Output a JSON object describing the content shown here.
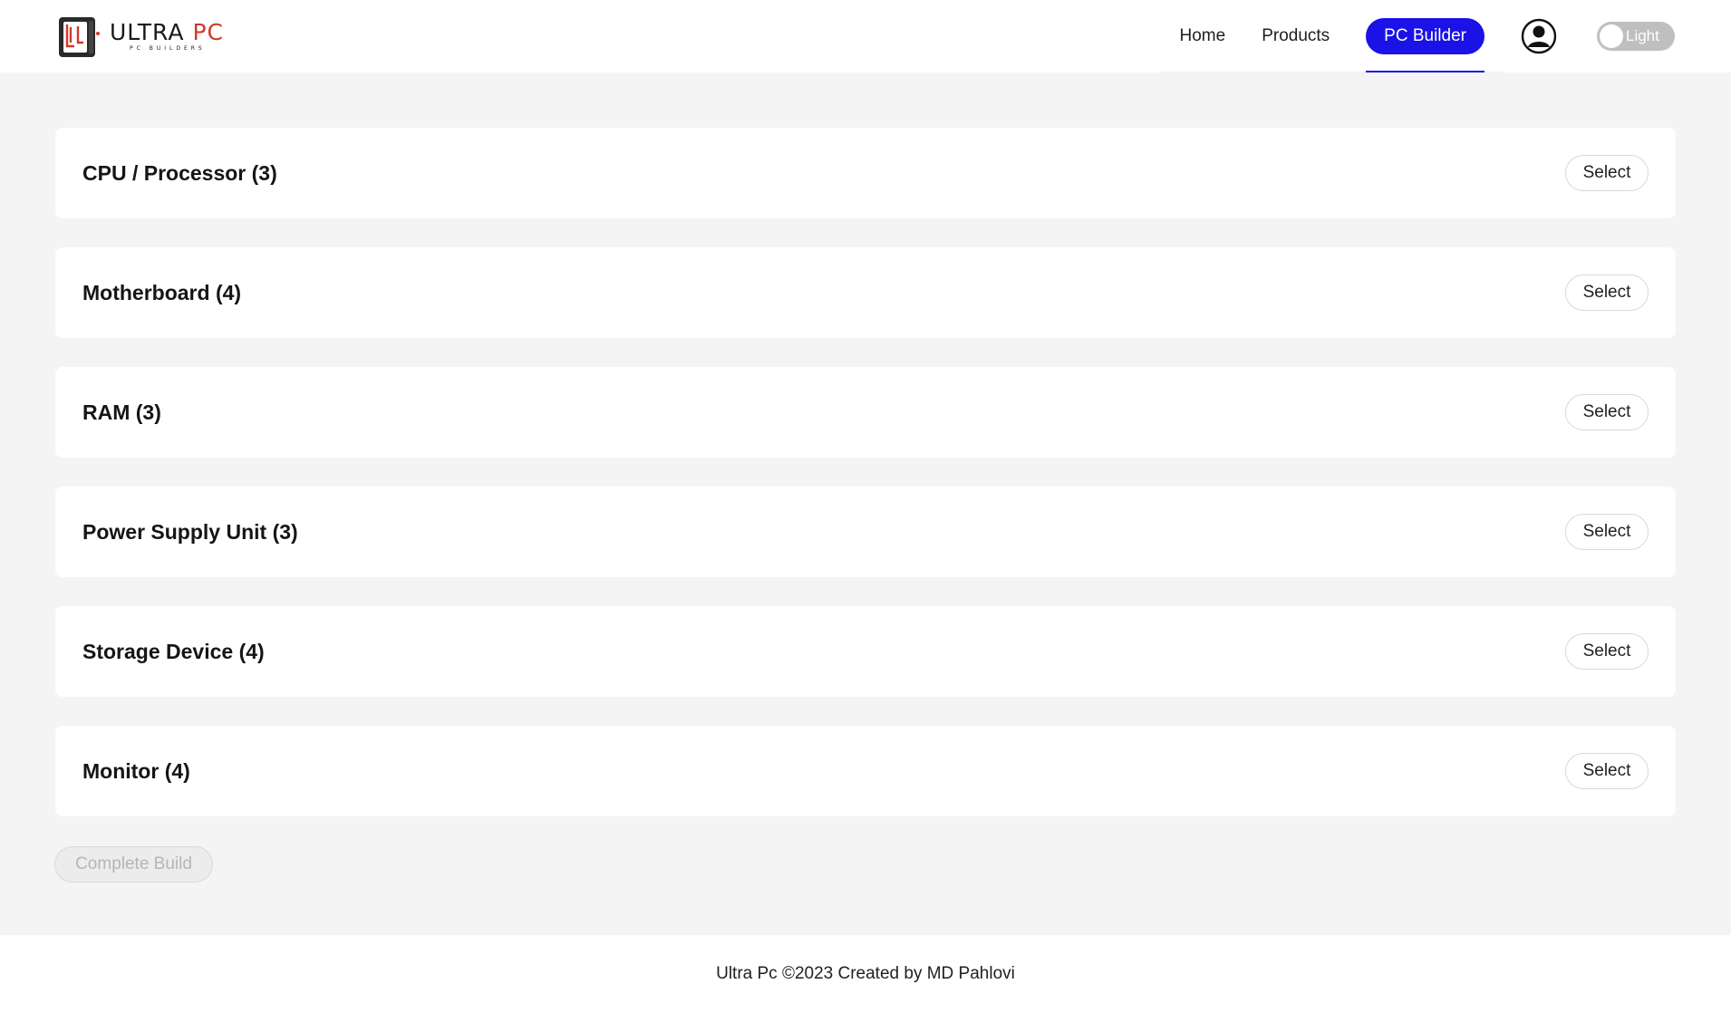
{
  "brand": {
    "name_part1": "ULTRA ",
    "name_part2": "PC",
    "tagline": "PC BUILDERS",
    "icon": "pc-case-logo-icon",
    "accent_color": "#d0392b"
  },
  "nav": {
    "items": [
      {
        "label": "Home",
        "active": false
      },
      {
        "label": "Products",
        "active": false
      },
      {
        "label": "PC Builder",
        "active": true
      }
    ],
    "active_color": "#1a12e6",
    "user_icon": "user-circle-icon",
    "theme_toggle": {
      "label": "Light",
      "on": false
    }
  },
  "categories": [
    {
      "title": "CPU / Processor (3)",
      "action": "Select"
    },
    {
      "title": "Motherboard (4)",
      "action": "Select"
    },
    {
      "title": "RAM (3)",
      "action": "Select"
    },
    {
      "title": "Power Supply Unit (3)",
      "action": "Select"
    },
    {
      "title": "Storage Device (4)",
      "action": "Select"
    },
    {
      "title": "Monitor (4)",
      "action": "Select"
    }
  ],
  "complete_build": {
    "label": "Complete Build",
    "disabled": true
  },
  "footer": {
    "text": "Ultra Pc ©2023 Created by MD Pahlovi"
  }
}
